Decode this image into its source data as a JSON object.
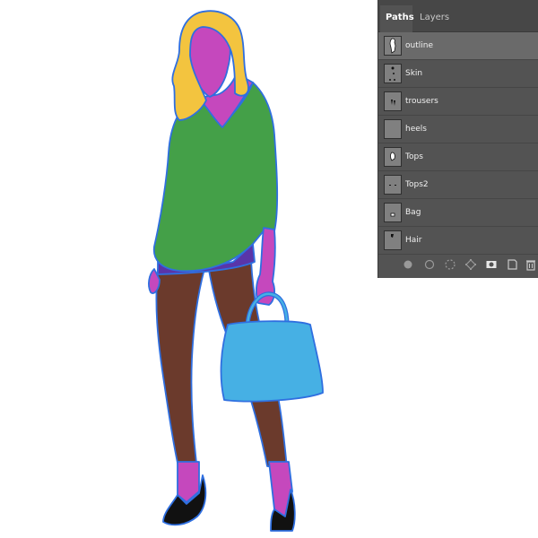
{
  "panel": {
    "tabs": [
      {
        "label": "Paths",
        "active": true
      },
      {
        "label": "Layers",
        "active": false
      }
    ],
    "paths": [
      {
        "label": "outline",
        "selected": true
      },
      {
        "label": "Skin",
        "selected": false
      },
      {
        "label": "trousers",
        "selected": false
      },
      {
        "label": "heels",
        "selected": false
      },
      {
        "label": "Tops",
        "selected": false
      },
      {
        "label": "Tops2",
        "selected": false
      },
      {
        "label": "Bag",
        "selected": false
      },
      {
        "label": "Hair",
        "selected": false
      }
    ],
    "footer_icons": [
      "fill-path-icon",
      "stroke-path-icon",
      "load-selection-icon",
      "make-work-path-icon",
      "add-mask-icon",
      "new-path-icon",
      "delete-icon"
    ]
  },
  "illustration": {
    "colors": {
      "hair": "#f3c43f",
      "skin": "#c548bd",
      "top": "#44a048",
      "shorts": "#5a35a8",
      "legs": "#6b3a2c",
      "bag": "#46b0e4",
      "heels": "#111111",
      "outline": "#2f6fe0"
    }
  }
}
